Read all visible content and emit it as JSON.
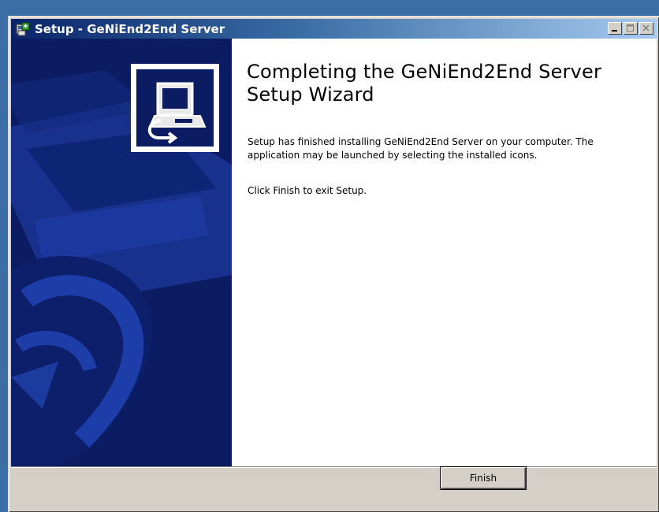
{
  "window": {
    "title": "Setup - GeNiEnd2End Server",
    "title_icon": "setup-installer-icon"
  },
  "title_buttons": {
    "minimize_icon": "minimize-icon",
    "maximize_icon": "maximize-icon",
    "close_icon": "close-icon"
  },
  "wizard": {
    "heading": "Completing the GeNiEnd2End Server Setup Wizard",
    "paragraph1": "Setup has finished installing GeNiEnd2End Server on your computer. The application may be launched by selecting the installed icons.",
    "paragraph2": "Click Finish to exit Setup.",
    "banner_icon": "computer-install-icon"
  },
  "buttons": {
    "finish_label": "Finish"
  },
  "colors": {
    "banner_dark": "#0c1c63",
    "banner_mid": "#1b3aa0",
    "titlebar_start": "#0a246a",
    "face": "#d4d0c8"
  }
}
